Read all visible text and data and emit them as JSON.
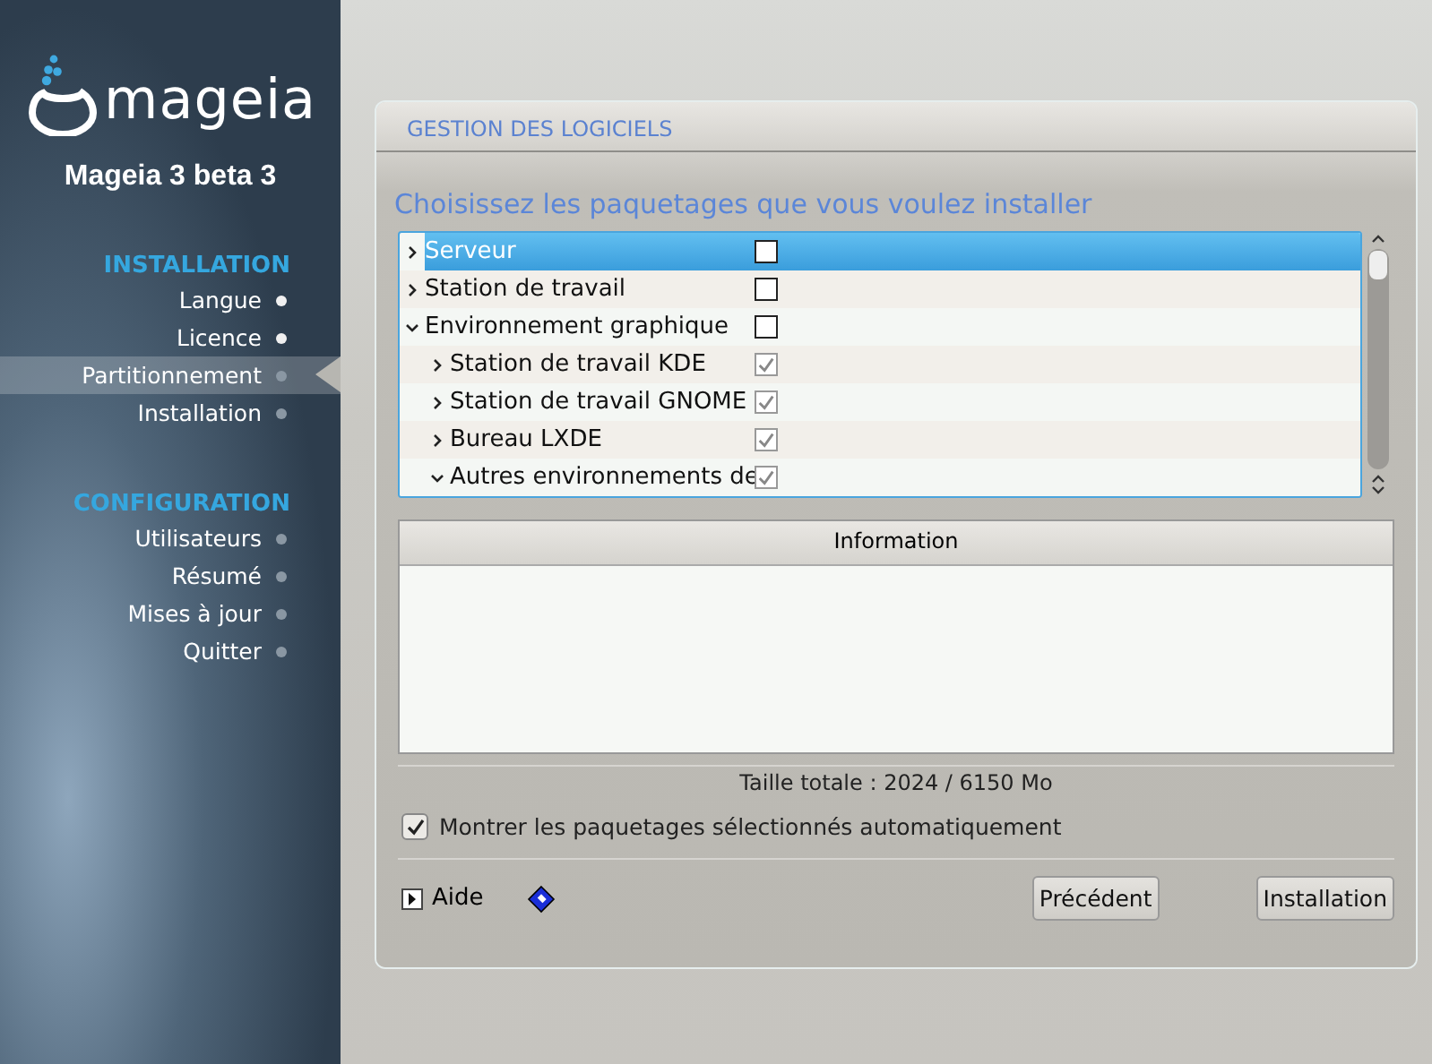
{
  "sidebar": {
    "product": "Mageia 3 beta 3",
    "logo_text": "mageia",
    "sections": [
      {
        "title": "INSTALLATION",
        "items": [
          {
            "label": "Langue",
            "done": true,
            "selected": false
          },
          {
            "label": "Licence",
            "done": true,
            "selected": false
          },
          {
            "label": "Partitionnement",
            "done": false,
            "selected": true
          },
          {
            "label": "Installation",
            "done": false,
            "selected": false
          }
        ]
      },
      {
        "title": "CONFIGURATION",
        "items": [
          {
            "label": "Utilisateurs",
            "done": false,
            "selected": false
          },
          {
            "label": "Résumé",
            "done": false,
            "selected": false
          },
          {
            "label": "Mises à jour",
            "done": false,
            "selected": false
          },
          {
            "label": "Quitter",
            "done": false,
            "selected": false
          }
        ]
      }
    ]
  },
  "panel": {
    "title": "GESTION DES LOGICIELS",
    "prompt": "Choisissez les paquetages que vous voulez installer",
    "tree": [
      {
        "label": "Serveur",
        "expanded": false,
        "checked": false,
        "disabled": false,
        "selected": true
      },
      {
        "label": "Station de travail",
        "expanded": false,
        "checked": false,
        "disabled": false,
        "selected": false
      },
      {
        "label": "Environnement graphique",
        "expanded": true,
        "checked": false,
        "disabled": false,
        "selected": false,
        "children": [
          {
            "label": "Station de travail KDE",
            "expanded": false,
            "checked": true,
            "disabled": true,
            "selected": false
          },
          {
            "label": "Station de travail GNOME",
            "expanded": false,
            "checked": true,
            "disabled": true,
            "selected": false
          },
          {
            "label": "Bureau LXDE",
            "expanded": false,
            "checked": true,
            "disabled": true,
            "selected": false
          },
          {
            "label": "Autres environnements de",
            "expanded": true,
            "checked": true,
            "disabled": true,
            "selected": false
          }
        ]
      }
    ],
    "info_header": "Information",
    "total_size": "Taille totale : 2024 / 6150 Mo",
    "show_auto": {
      "label": "Montrer les paquetages sélectionnés automatiquement",
      "checked": true
    },
    "help": "Aide",
    "buttons": [
      "Précédent",
      "Installation"
    ]
  }
}
